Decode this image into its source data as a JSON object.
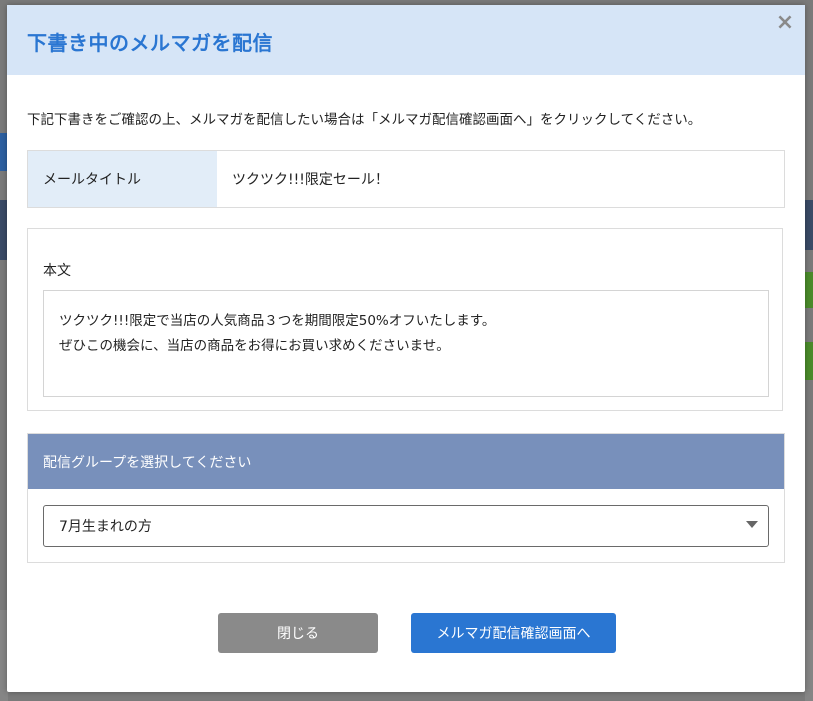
{
  "modal": {
    "title": "下書き中のメルマガを配信",
    "close_symbol": "×",
    "intro": "下記下書きをご確認の上、メルマガを配信したい場合は「メルマガ配信確認画面へ」をクリックしてください。"
  },
  "mail_title": {
    "label": "メールタイトル",
    "value": "ツクツク!!!限定セール！"
  },
  "body": {
    "label": "本文",
    "lines": [
      "ツクツク!!!限定で当店の人気商品３つを期間限定50%オフいたします。",
      "ぜひこの機会に、当店の商品をお得にお買い求めくださいませ。"
    ]
  },
  "group": {
    "header": "配信グループを選択してください",
    "selected": "7月生まれの方"
  },
  "buttons": {
    "close": "閉じる",
    "confirm": "メルマガ配信確認画面へ"
  },
  "colors": {
    "accent": "#2a76d2",
    "header_bg": "#d6e5f7",
    "group_header_bg": "#7890bb",
    "close_button_bg": "#8a8a8a"
  }
}
